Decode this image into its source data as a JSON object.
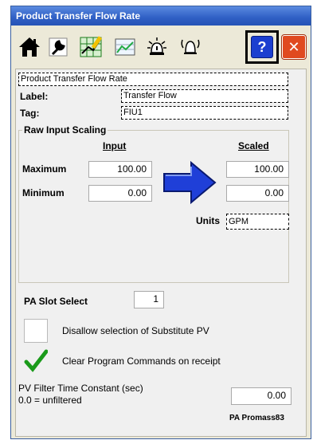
{
  "window": {
    "title": "Product Transfer Flow Rate"
  },
  "toolbar": {
    "buttons": [
      {
        "name": "home-icon"
      },
      {
        "name": "wrench-icon"
      },
      {
        "name": "trend-edit-icon"
      },
      {
        "name": "trend-icon"
      },
      {
        "name": "alarm-icon"
      },
      {
        "name": "bell-icon"
      },
      {
        "name": "help-icon",
        "glyph": "?"
      },
      {
        "name": "close-icon",
        "glyph": "✕"
      }
    ]
  },
  "header": {
    "description": "Product Transfer Flow Rate",
    "label_caption": "Label:",
    "label_value": "Transfer Flow",
    "tag_caption": "Tag:",
    "tag_value": "FIU1"
  },
  "scaling": {
    "title": "Raw Input Scaling",
    "input_header": "Input",
    "scaled_header": "Scaled",
    "maximum_label": "Maximum",
    "minimum_label": "Minimum",
    "input_max": "100.00",
    "input_min": "0.00",
    "scaled_max": "100.00",
    "scaled_min": "0.00",
    "units_label": "Units",
    "units_value": "GPM"
  },
  "options": {
    "pa_slot_label": "PA Slot Select",
    "pa_slot_value": "1",
    "disallow_label": "Disallow selection of Substitute PV",
    "disallow_checked": false,
    "clear_label": "Clear Program Commands on receipt",
    "clear_checked": true,
    "filter_label_1": "PV Filter Time Constant (sec)",
    "filter_label_2": "0.0 = unfiltered",
    "filter_value": "0.00",
    "footer": "PA Promass83"
  },
  "colors": {
    "titlebar": "#2f5fc4",
    "arrow": "#1f3fd8",
    "check": "#1a9a1a",
    "close": "#e04a20",
    "help": "#1c3fd0"
  }
}
